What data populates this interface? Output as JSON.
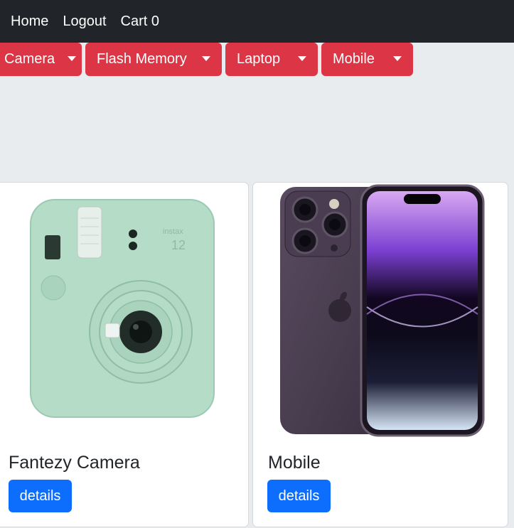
{
  "nav": {
    "home": "Home",
    "logout": "Logout",
    "cart": "Cart 0"
  },
  "categories": [
    {
      "label": "Camera"
    },
    {
      "label": "Flash Memory"
    },
    {
      "label": "Laptop"
    },
    {
      "label": "Mobile"
    }
  ],
  "products": [
    {
      "title": "Fantezy Camera",
      "button": "details",
      "image": "instax-camera-image"
    },
    {
      "title": "Mobile",
      "button": "details",
      "image": "iphone-image"
    }
  ],
  "colors": {
    "navbar": "#212529",
    "category_button": "#dc3545",
    "details_button": "#0d6efd",
    "page_background": "#e9ecef"
  }
}
